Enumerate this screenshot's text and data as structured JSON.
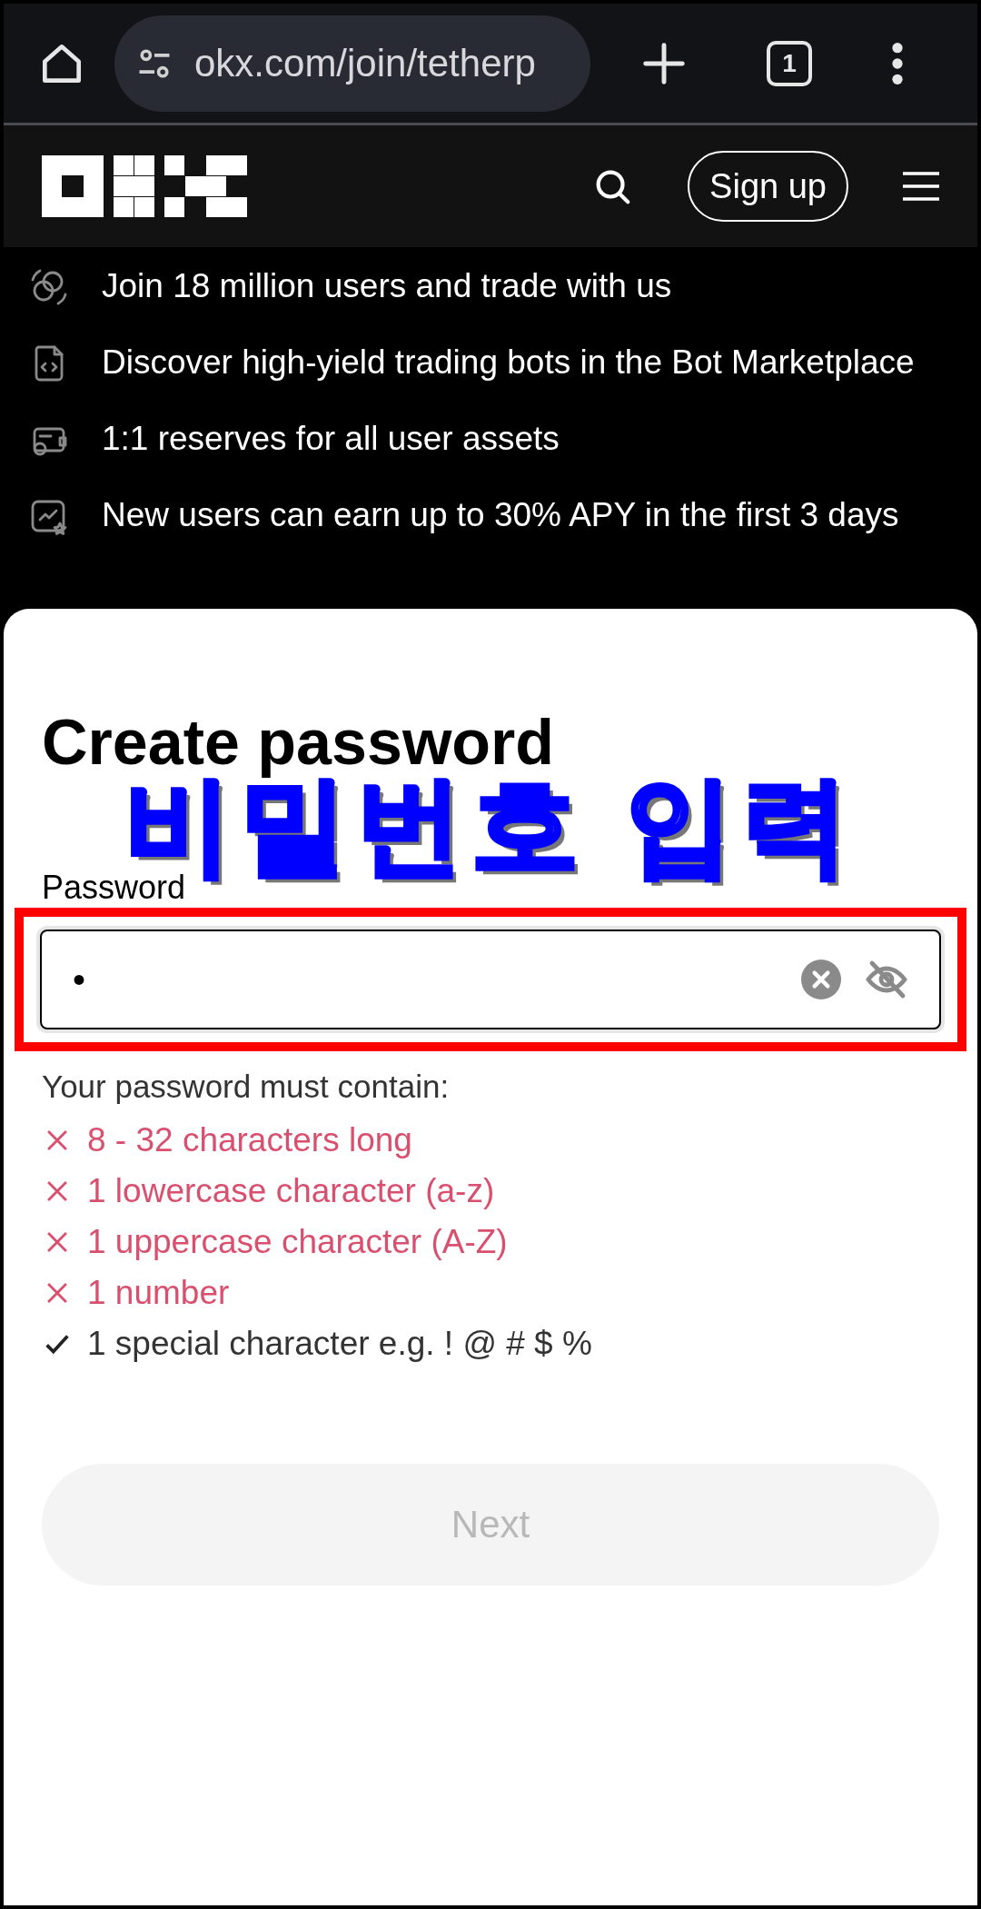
{
  "browser": {
    "url": "okx.com/join/tetherp",
    "tab_count": "1"
  },
  "header": {
    "signup": "Sign up"
  },
  "features": [
    {
      "kind": "coins",
      "text": "Join 18 million users and trade with us"
    },
    {
      "kind": "code",
      "text": "Discover high-yield trading bots in the Bot Marketplace"
    },
    {
      "kind": "wallet",
      "text": "1:1 reserves for all user assets"
    },
    {
      "kind": "chart",
      "text": "New users can earn up to 30% APY in the first 3 days"
    }
  ],
  "form": {
    "title": "Create password",
    "annotation": "비밀번호 입력",
    "label": "Password",
    "value": "•",
    "requirements_title": "Your password must contain:",
    "requirements": [
      {
        "text": "8 - 32 characters long",
        "met": false
      },
      {
        "text": "1 lowercase character (a-z)",
        "met": false
      },
      {
        "text": "1 uppercase character (A-Z)",
        "met": false
      },
      {
        "text": "1 number",
        "met": false
      },
      {
        "text": "1 special character e.g. ! @ # $ %",
        "met": true
      }
    ],
    "next": {
      "label": "Next",
      "disabled": true
    }
  }
}
